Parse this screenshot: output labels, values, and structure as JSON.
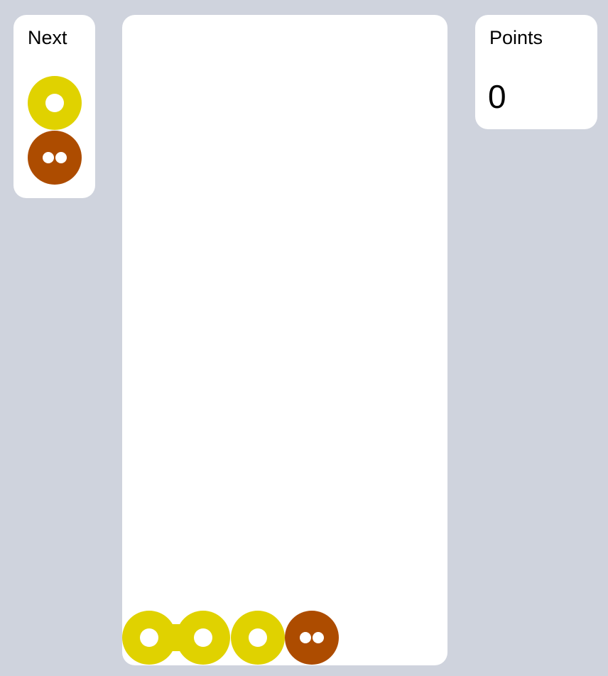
{
  "next": {
    "title": "Next",
    "pieces": [
      {
        "type": "ring",
        "color": "#e0d200"
      },
      {
        "type": "two-dot",
        "color": "#ad4c00"
      }
    ]
  },
  "points": {
    "title": "Points",
    "value": "0"
  },
  "board": {
    "bottom_row": [
      {
        "type": "ring",
        "color": "#e0d200",
        "linked_right": true
      },
      {
        "type": "ring",
        "color": "#e0d200",
        "linked_right": false
      },
      {
        "type": "ring",
        "color": "#e0d200",
        "linked_right": false
      },
      {
        "type": "two-dot",
        "color": "#ad4c00",
        "linked_right": false
      }
    ]
  },
  "colors": {
    "background": "#cfd3dd",
    "panel": "#ffffff",
    "yellow": "#e0d200",
    "brown": "#ad4c00"
  }
}
